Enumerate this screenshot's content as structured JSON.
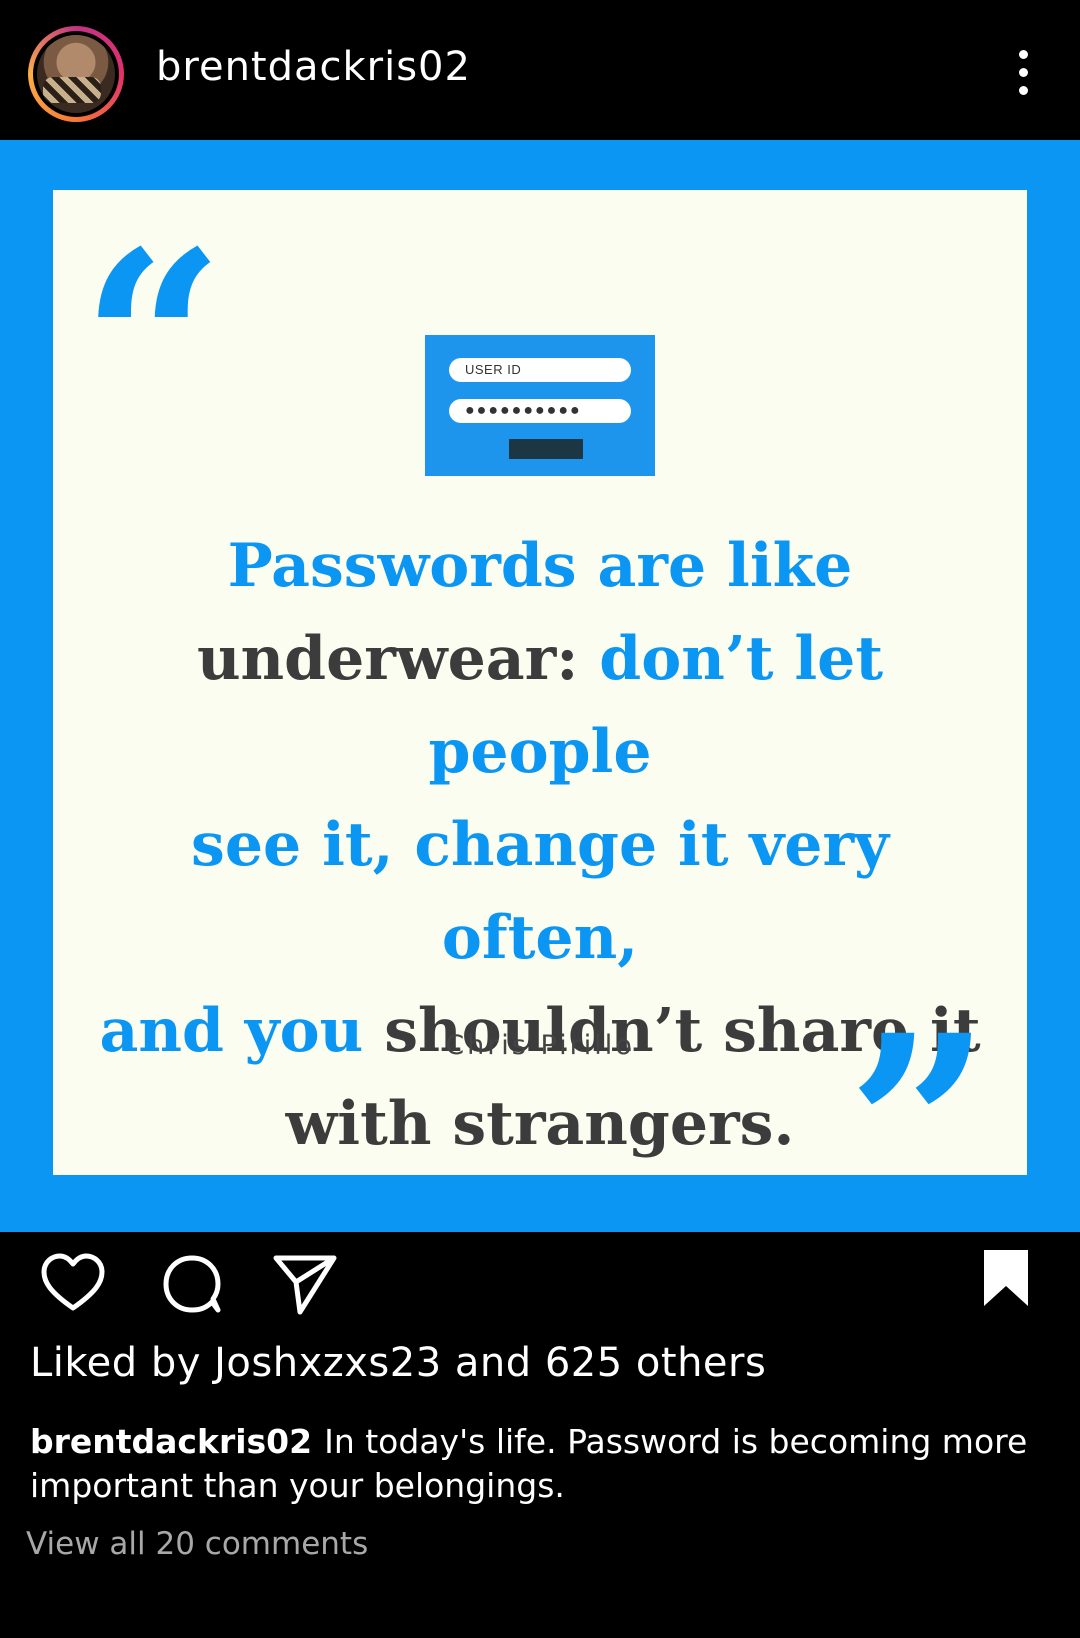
{
  "header": {
    "username": "brentdackris02",
    "more_icon": "more-vertical-icon"
  },
  "post": {
    "login_graphic": {
      "user_label": "USER ID",
      "password_mask": "●●●●●●●●●●"
    },
    "quote": {
      "line1_blue": "Passwords are like",
      "line2_dark": "underwear: ",
      "line2_blue": "don’t let people",
      "line3_blue": "see it, change it very often,",
      "line4_blue": "and you ",
      "line4_dark": "shouldn’t share it",
      "line5_dark": "with strangers.",
      "author": "Chris Pirillo"
    },
    "quote_marks": {
      "open": "“",
      "close": "”"
    },
    "colors": {
      "accent": "#0a96f2",
      "card": "#fbfdf0",
      "text_dark": "#3c3c3c"
    }
  },
  "actions": {
    "like_icon": "heart-icon",
    "comment_icon": "comment-icon",
    "share_icon": "send-icon",
    "save_icon": "bookmark-icon"
  },
  "meta": {
    "likes_text": "Liked by Joshxzxs23 and 625 others",
    "caption_user": "brentdackris02",
    "caption_text": "In today's life. Password is becoming more important than your belongings.",
    "view_comments": "View all 20 comments"
  }
}
